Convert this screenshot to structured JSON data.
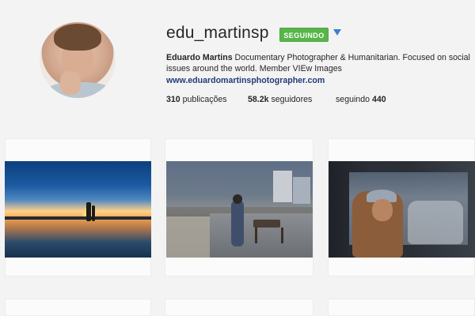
{
  "profile": {
    "username": "edu_martinsp",
    "follow_button_label": "SEGUINDO",
    "bio_name": "Eduardo Martins",
    "bio_text": " Documentary Photographer & Humanitarian. Focused on social issues around the world. Member VIEw Images",
    "website": "www.eduardomartinsphotographer.com",
    "stats": {
      "posts_count": "310",
      "posts_label": "publicações",
      "followers_count": "58.2k",
      "followers_label": "seguidores",
      "following_label": "seguindo",
      "following_count": "440"
    }
  },
  "icons": {
    "dropdown": "caret-down-icon"
  },
  "colors": {
    "follow_button": "#58b54a",
    "dropdown_caret": "#3a7fd0",
    "link_text": "#1f3d78"
  }
}
